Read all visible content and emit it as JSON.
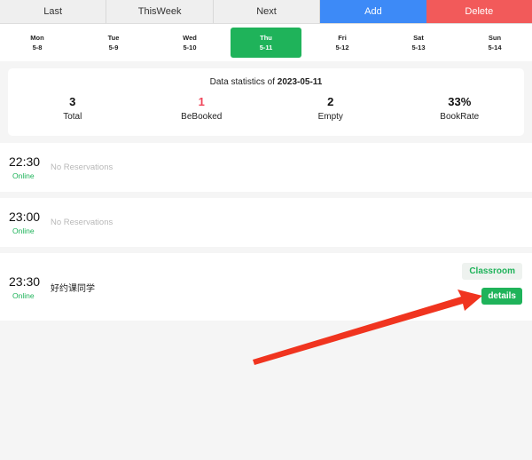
{
  "toolbar": {
    "last": "Last",
    "this_week": "ThisWeek",
    "next": "Next",
    "add": "Add",
    "delete": "Delete"
  },
  "week": [
    {
      "day": "Mon",
      "date": "5-8"
    },
    {
      "day": "Tue",
      "date": "5-9"
    },
    {
      "day": "Wed",
      "date": "5-10"
    },
    {
      "day": "Thu",
      "date": "5-11"
    },
    {
      "day": "Fri",
      "date": "5-12"
    },
    {
      "day": "Sat",
      "date": "5-13"
    },
    {
      "day": "Sun",
      "date": "5-14"
    }
  ],
  "active_day_index": 3,
  "stats": {
    "title_prefix": "Data statistics of",
    "title_date": "2023-05-11",
    "total_value": "3",
    "total_label": "Total",
    "booked_value": "1",
    "booked_label": "BeBooked",
    "empty_value": "2",
    "empty_label": "Empty",
    "rate_value": "33%",
    "rate_label": "BookRate"
  },
  "slots": [
    {
      "time": "22:30",
      "status": "Online",
      "text": "No Reservations"
    },
    {
      "time": "23:00",
      "status": "Online",
      "text": "No Reservations"
    },
    {
      "time": "23:30",
      "status": "Online",
      "text": "好约课同学",
      "classroom_label": "Classroom",
      "details_label": "details"
    }
  ],
  "colors": {
    "green": "#1fb35a",
    "blue": "#3d8af7",
    "red": "#f25a5a",
    "arrow": "#f0341f"
  }
}
